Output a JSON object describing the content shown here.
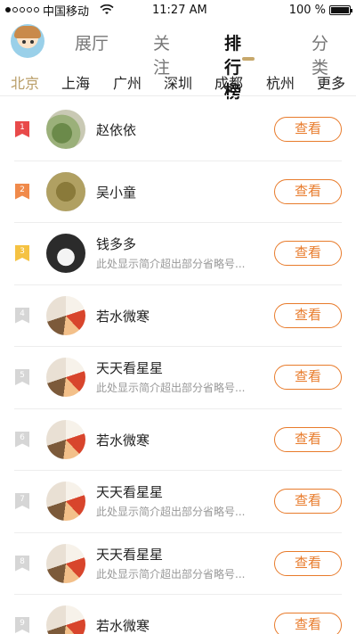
{
  "status_bar": {
    "carrier": "中国移动",
    "time": "11:27 AM",
    "battery": "100 %",
    "battery_level": 1.0
  },
  "header": {
    "tabs": [
      {
        "label": "展厅"
      },
      {
        "label": "关注"
      },
      {
        "label": "排行榜",
        "active": true
      },
      {
        "label": "分类"
      }
    ]
  },
  "cities": [
    {
      "label": "北京",
      "active": true
    },
    {
      "label": "上海"
    },
    {
      "label": "广州"
    },
    {
      "label": "深圳"
    },
    {
      "label": "成都"
    },
    {
      "label": "杭州"
    },
    {
      "label": "更多"
    }
  ],
  "ranking": [
    {
      "rank": "1",
      "name": "赵依依",
      "desc": ""
    },
    {
      "rank": "2",
      "name": "吴小童",
      "desc": ""
    },
    {
      "rank": "3",
      "name": "钱多多",
      "desc": "此处显示简介超出部分省略号..."
    },
    {
      "rank": "4",
      "name": "若水微寒",
      "desc": ""
    },
    {
      "rank": "5",
      "name": "天天看星星",
      "desc": "此处显示简介超出部分省略号..."
    },
    {
      "rank": "6",
      "name": "若水微寒",
      "desc": ""
    },
    {
      "rank": "7",
      "name": "天天看星星",
      "desc": "此处显示简介超出部分省略号..."
    },
    {
      "rank": "8",
      "name": "天天看星星",
      "desc": "此处显示简介超出部分省略号..."
    },
    {
      "rank": "9",
      "name": "若水微寒",
      "desc": ""
    }
  ],
  "view_button_label": "查看",
  "colors": {
    "accent": "#e87b2b",
    "gold": "#b99d66",
    "rank1": "#e84a4a",
    "rank2": "#f08a4b",
    "rank3": "#f5c242",
    "rank_other": "#d6d6d6"
  }
}
